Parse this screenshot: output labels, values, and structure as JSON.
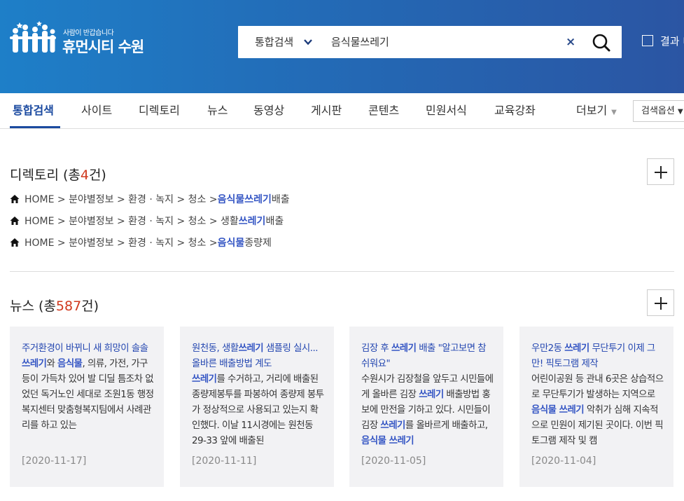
{
  "header": {
    "logo_sub": "사람이 반갑습니다",
    "logo_main": "휴먼시티 수원",
    "search_select": "통합검색",
    "search_query": "음식물쓰레기",
    "clear_symbol": "×",
    "check_label": "결과 내"
  },
  "tabs": [
    {
      "label": "통합검색"
    },
    {
      "label": "사이트"
    },
    {
      "label": "디렉토리"
    },
    {
      "label": "뉴스"
    },
    {
      "label": "동영상"
    },
    {
      "label": "게시판"
    },
    {
      "label": "콘텐츠"
    },
    {
      "label": "민원서식"
    },
    {
      "label": "교육강좌"
    },
    {
      "label": "더보기"
    }
  ],
  "options_button": "검색옵션",
  "directory": {
    "title_prefix": "디렉토리 (총",
    "count": "4",
    "title_suffix": "건)",
    "rows": [
      {
        "path": "HOME > 분야별정보 > 환경 · 녹지 > 청소 > ",
        "highlight": "음식물쓰레기",
        "rest": " 배출"
      },
      {
        "path": "HOME > 분야별정보 > 환경 · 녹지 > 청소 > 생활",
        "highlight": "쓰레기",
        "rest": " 배출"
      },
      {
        "path": "HOME > 분야별정보 > 환경 · 녹지 > 청소 > ",
        "highlight": "음식물",
        "rest": "종량제"
      }
    ]
  },
  "news": {
    "title_prefix": "뉴스 (총",
    "count": "587",
    "title_suffix": "건)",
    "cards": [
      {
        "title": "주거환경이 바뀌니 새 희망이 솔솔",
        "body_html": "<span class=\"hl\">쓰레기</span>와 <span class=\"hl\">음식물</span>, 의류, 가전, 가구 등이 가득차 있어 발 디딜 틈조차 없었던 독거노인 세대로 조원1동 행정복지센터 맞춤형복지팀에서 사례관리를 하고 있는",
        "date": "[2020-11-17]"
      },
      {
        "title_html": "원천동, 생활<span class=\"hl\">쓰레기</span> 샘플링 실시...올바른 배출방법 계도",
        "body_html": "<span class=\"hl\">쓰레기</span>를 수거하고, 거리에 배출된 종량제봉투를 파봉하여 종량제 봉투가 정상적으로 사용되고 있는지 확인했다. 이날 11시경에는 원천동 29-33 앞에 배출된",
        "date": "[2020-11-11]"
      },
      {
        "title_html": "김장 후 <span class=\"hl\">쓰레기</span> 배출 \"알고보면 참 쉬워요\"",
        "body_html": "수원시가 김장철을 앞두고 시민들에게 올바른 김장 <span class=\"hl\">쓰레기</span> 배출방법 홍보에 만전을 기하고 있다. 시민들이 김장 <span class=\"hl\">쓰레기</span>를 올바르게 배출하고, <span class=\"hl\">음식물 쓰레기</span>",
        "date": "[2020-11-05]"
      },
      {
        "title_html": "우만2동 <span class=\"hl\">쓰레기</span> 무단투기 이제 그만! 픽토그램 제작",
        "body_html": "어린이공원 등 관내 6곳은 상습적으로 무단투기가 발생하는 지역으로 <span class=\"hl\">음식물 쓰레기</span> 악취가 심해 지속적으로 민원이 제기된 곳이다. 이번 픽토그램 제작 및 캠",
        "date": "[2020-11-04]"
      }
    ]
  },
  "colors": {
    "header_start": "#1e7fc8",
    "header_end": "#2b55a3",
    "highlight": "#3556c4",
    "count": "#d0391e",
    "card_bg": "#f2f2f4"
  }
}
